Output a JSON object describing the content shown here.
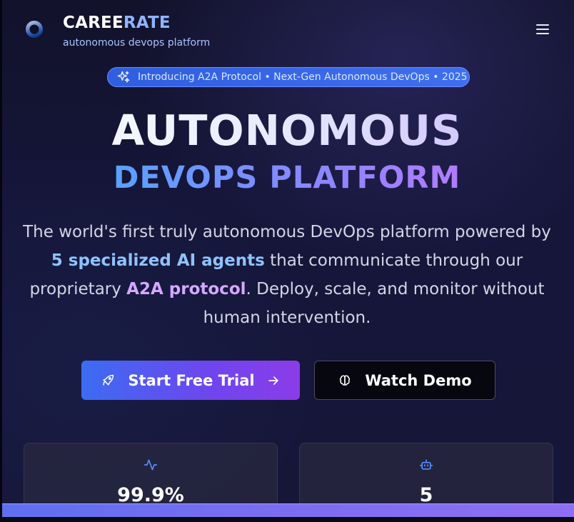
{
  "header": {
    "brand_main": "CAREE",
    "brand_highlight": "RATE",
    "tagline": "autonomous devops platform",
    "logo_icon": "globe-logo-icon",
    "menu_icon": "hamburger-menu-icon"
  },
  "announcement": {
    "icon": "sparkles-icon",
    "text": "Introducing A2A Protocol • Next-Gen Autonomous DevOps • 2025"
  },
  "hero": {
    "title_line1": "AUTONOMOUS",
    "title_line2": "DEVOPS PLATFORM",
    "description": {
      "part1": "The world's first truly autonomous DevOps platform powered by ",
      "highlight1": "5 specialized AI agents",
      "part2": " that communicate through our proprietary ",
      "highlight2": "A2A protocol",
      "part3": ". Deploy, scale, and monitor without human intervention."
    }
  },
  "cta": {
    "primary_label": "Start Free Trial",
    "primary_icon": "rocket-icon",
    "primary_trailing_icon": "arrow-right-icon",
    "secondary_label": "Watch Demo",
    "secondary_icon": "brain-icon"
  },
  "stats": [
    {
      "icon": "activity-icon",
      "value": "99.9%"
    },
    {
      "icon": "bot-icon",
      "value": "5"
    }
  ],
  "colors": {
    "accent_blue": "#3c6cf2",
    "accent_purple": "#8b3ce8",
    "highlight_blue": "#8fc3ff",
    "highlight_purple": "#d4a8ff"
  }
}
